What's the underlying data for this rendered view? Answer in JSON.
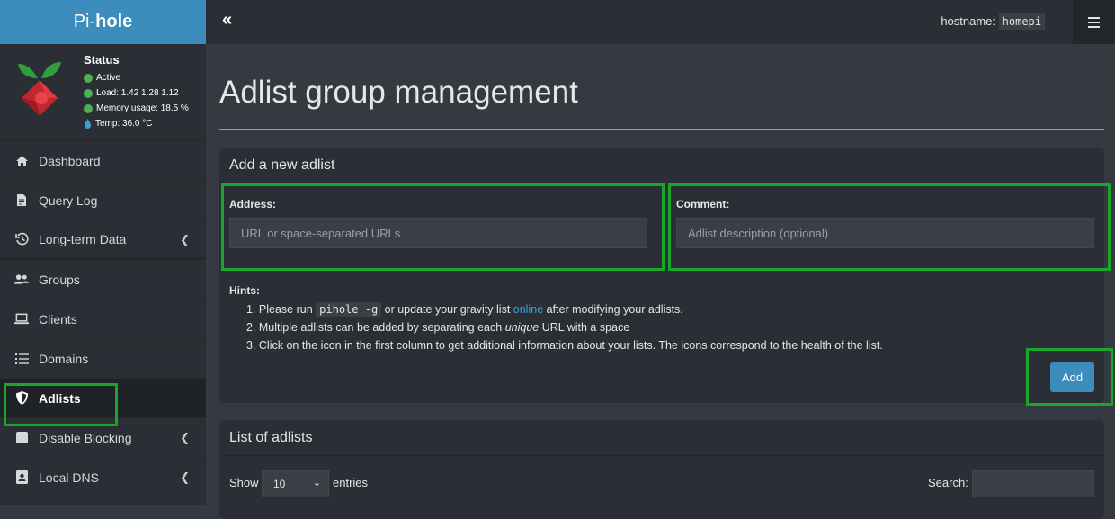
{
  "brand": {
    "prefix": "Pi-",
    "name": "hole"
  },
  "status": {
    "title": "Status",
    "active": "Active",
    "load": "Load:  1.42  1.28  1.12",
    "memory": "Memory usage:  18.5 %",
    "temp": "Temp: 36.0 °C"
  },
  "sidebar": {
    "items": [
      {
        "label": "Dashboard",
        "icon": "home-icon"
      },
      {
        "label": "Query Log",
        "icon": "file-icon"
      },
      {
        "label": "Long-term Data",
        "icon": "history-icon"
      },
      {
        "label": "Groups",
        "icon": "users-icon"
      },
      {
        "label": "Clients",
        "icon": "laptop-icon"
      },
      {
        "label": "Domains",
        "icon": "list-icon"
      },
      {
        "label": "Adlists",
        "icon": "shield-icon"
      },
      {
        "label": "Disable Blocking",
        "icon": "stop-icon"
      },
      {
        "label": "Local DNS",
        "icon": "address-book-icon"
      }
    ]
  },
  "topbar": {
    "collapse": "«",
    "hostname_label": "hostname:",
    "hostname_value": "homepi"
  },
  "page": {
    "title": "Adlist group management"
  },
  "add_card": {
    "title": "Add a new adlist",
    "address_label": "Address:",
    "address_placeholder": "URL or space-separated URLs",
    "comment_label": "Comment:",
    "comment_placeholder": "Adlist description (optional)",
    "hints_label": "Hints:",
    "hint1_a": "1. Please run ",
    "hint1_code": "pihole -g",
    "hint1_b": " or update your gravity list ",
    "hint1_link": "online",
    "hint1_c": " after modifying your adlists.",
    "hint2_a": "2. Multiple adlists can be added by separating each ",
    "hint2_em": "unique",
    "hint2_b": " URL with a space",
    "hint3": "3. Click on the icon in the first column to get additional information about your lists. The icons correspond to the health of the list.",
    "add_button": "Add"
  },
  "list_card": {
    "title": "List of adlists",
    "show": "Show",
    "entries_value": "10",
    "entries": "entries",
    "search": "Search:"
  },
  "colors": {
    "brand": "#3c8dbc",
    "highlight": "#1aa52b",
    "status_ok": "#4caf50",
    "link": "#3c9fd6"
  }
}
